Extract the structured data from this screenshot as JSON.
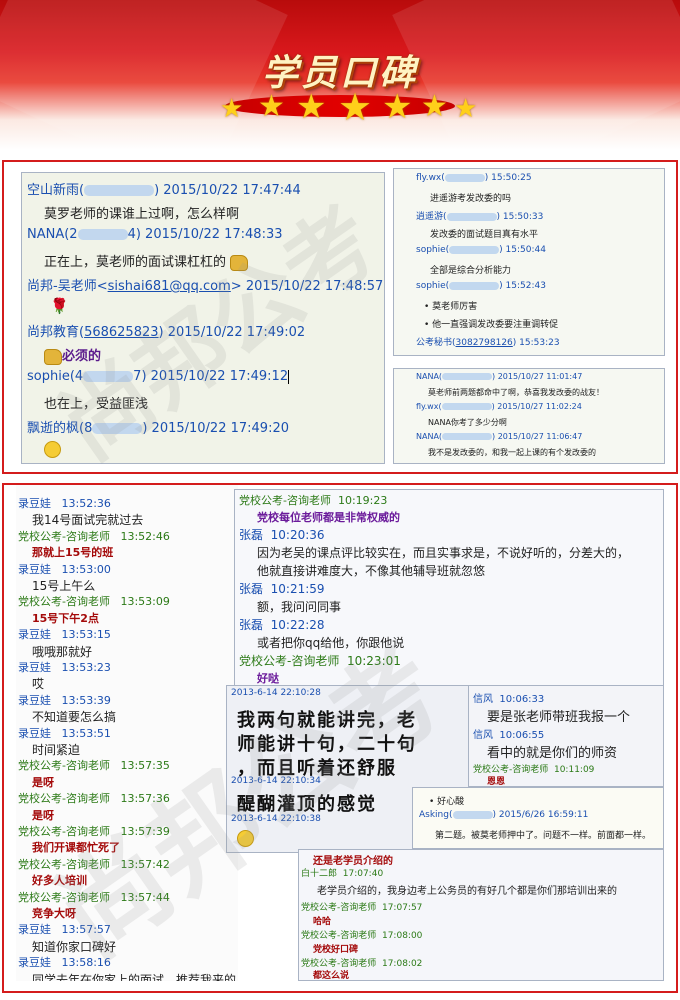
{
  "banner": {
    "title": "学员口碑"
  },
  "panel1": {
    "left_chat": [
      {
        "type": "name",
        "name": "空山新雨(",
        "tail": ") 2015/10/22 17:47:44"
      },
      {
        "type": "msg",
        "text": "莫罗老师的课谁上过啊，怎么样啊"
      },
      {
        "type": "name",
        "name": "NANA(2",
        "tail": "4) 2015/10/22 17:48:33"
      },
      {
        "type": "msg",
        "text": "正在上，莫老师的面试课杠杠的"
      },
      {
        "type": "name",
        "name": "尚邦-吴老师<",
        "email": "sishai681@qq.com",
        "tail": "> 2015/10/22 17:48:57"
      },
      {
        "type": "name",
        "name": "尚邦教育(",
        "qq": "568625823",
        "tail": ") 2015/10/22 17:49:02"
      },
      {
        "type": "msg",
        "text": "必须的"
      },
      {
        "type": "name",
        "name": "sophie(4",
        "tail": "7) 2015/10/22 17:49:12"
      },
      {
        "type": "msg",
        "text": "也在上，受益匪浅"
      },
      {
        "type": "name",
        "name": "飘逝的枫(8",
        "tail": ") 2015/10/22 17:49:20"
      }
    ],
    "right_top": [
      {
        "type": "name",
        "name": "fly.wx(",
        "tail": ") 15:50:25"
      },
      {
        "type": "msg",
        "text": "进遥游考发改委的吗"
      },
      {
        "type": "name",
        "name": "逍遥游(",
        "tail": ") 15:50:33"
      },
      {
        "type": "msg",
        "text": "发改委的面试题目真有水平"
      },
      {
        "type": "name",
        "name": "sophie(",
        "tail": ") 15:50:44"
      },
      {
        "type": "msg",
        "text": "全部是综合分析能力"
      },
      {
        "type": "name",
        "name": "sophie(",
        "tail": ") 15:52:43"
      },
      {
        "type": "msg",
        "text": "• 莫老师厉害"
      },
      {
        "type": "msg",
        "text": "• 他一直强调发改委要注重调转促"
      },
      {
        "type": "name",
        "name": "公考秘书(",
        "qq": "3082798126",
        "tail": ") 15:53:23"
      }
    ],
    "right_bottom": [
      {
        "type": "name",
        "name": "NANA(",
        "tail": ") 2015/10/27 11:01:47"
      },
      {
        "type": "msg",
        "text": "莫老师前两题都命中了啊，恭喜我发改委的战友！"
      },
      {
        "type": "name",
        "name": "fly.wx(",
        "tail": ") 2015/10/27 11:02:24"
      },
      {
        "type": "msg",
        "text": "NANA你考了多少分啊"
      },
      {
        "type": "name",
        "name": "NANA(",
        "tail": ") 2015/10/27 11:06:47"
      },
      {
        "type": "msg",
        "text": "我不是发改委的，和我一起上课的有个发改委的"
      }
    ]
  },
  "panel2": {
    "left_col": [
      {
        "type": "name",
        "name": "录豆娃",
        "tail": "13:52:36"
      },
      {
        "type": "msg",
        "text": "我14号面试完就过去"
      },
      {
        "type": "teacher",
        "name": "党校公考-咨询老师",
        "tail": "13:52:46"
      },
      {
        "type": "red",
        "text": "那就上15号的班"
      },
      {
        "type": "name",
        "name": "录豆娃",
        "tail": "13:53:00"
      },
      {
        "type": "msg",
        "text": "15号上午么"
      },
      {
        "type": "teacher",
        "name": "党校公考-咨询老师",
        "tail": "13:53:09"
      },
      {
        "type": "red",
        "text": "15号下午2点"
      },
      {
        "type": "name",
        "name": "录豆娃",
        "tail": "13:53:15"
      },
      {
        "type": "msg",
        "text": "哦哦那就好"
      },
      {
        "type": "name",
        "name": "录豆娃",
        "tail": "13:53:23"
      },
      {
        "type": "msg",
        "text": "哎"
      },
      {
        "type": "name",
        "name": "录豆娃",
        "tail": "13:53:39"
      },
      {
        "type": "msg",
        "text": "不知道要怎么搞"
      },
      {
        "type": "name",
        "name": "录豆娃",
        "tail": "13:53:51"
      },
      {
        "type": "msg",
        "text": "时间紧迫"
      },
      {
        "type": "teacher",
        "name": "党校公考-咨询老师",
        "tail": "13:57:35"
      },
      {
        "type": "red",
        "text": "是呀"
      },
      {
        "type": "teacher",
        "name": "党校公考-咨询老师",
        "tail": "13:57:36"
      },
      {
        "type": "red",
        "text": "是呀"
      },
      {
        "type": "teacher",
        "name": "党校公考-咨询老师",
        "tail": "13:57:39"
      },
      {
        "type": "red",
        "text": "我们开课都忙死了"
      },
      {
        "type": "teacher",
        "name": "党校公考-咨询老师",
        "tail": "13:57:42"
      },
      {
        "type": "red",
        "text": "好多人培训"
      },
      {
        "type": "teacher",
        "name": "党校公考-咨询老师",
        "tail": "13:57:44"
      },
      {
        "type": "red",
        "text": "竞争大呀"
      },
      {
        "type": "name",
        "name": "录豆娃",
        "tail": "13:57:57"
      },
      {
        "type": "msg",
        "text": "知道你家口碑好"
      },
      {
        "type": "name",
        "name": "录豆娃",
        "tail": "13:58:16"
      },
      {
        "type": "msg",
        "text": "同学去年在你家上的面试，推荐我来的"
      }
    ],
    "top_right": [
      {
        "type": "teacher",
        "name": "党校公考-咨询老师",
        "tail": "10:19:23"
      },
      {
        "type": "purple",
        "text": "党校每位老师都是非常权威的"
      },
      {
        "type": "name",
        "name": "张磊",
        "tail": "10:20:36"
      },
      {
        "type": "msg",
        "text": "因为老吴的课点评比较实在，而且实事求是，不说好听的，分差大的，"
      },
      {
        "type": "msg",
        "text": "他就直接讲难度大，不像其他辅导班就忽悠"
      },
      {
        "type": "name",
        "name": "张磊",
        "tail": "10:21:59"
      },
      {
        "type": "msg",
        "text": "额，我问问同事"
      },
      {
        "type": "name",
        "name": "张磊",
        "tail": "10:22:28"
      },
      {
        "type": "msg",
        "text": "或者把你qq给他，你跟他说"
      },
      {
        "type": "teacher",
        "name": "党校公考-咨询老师",
        "tail": "10:23:01"
      },
      {
        "type": "purple",
        "text": "好哒"
      }
    ],
    "mid_box": {
      "t1": "2013-6-14 22:10:28",
      "h1": "我两句就能讲完，老",
      "h2": "师能讲十句，二十句",
      "h3": "，而且听着还舒服",
      "t2": "2013-6-14 22:10:34",
      "h4": "醍醐灌顶的感觉",
      "t3": "2013-6-14 22:10:38"
    },
    "right_box": [
      {
        "type": "name",
        "name": "信风",
        "tail": "10:06:33"
      },
      {
        "type": "msg",
        "text": "要是张老师带班我报一个"
      },
      {
        "type": "name",
        "name": "信风",
        "tail": "10:06:55"
      },
      {
        "type": "msg",
        "text": "看中的就是你们的师资"
      },
      {
        "type": "teacher",
        "name": "党校公考-咨询老师",
        "tail": "10:11:09"
      },
      {
        "type": "red",
        "text": "恩恩"
      }
    ],
    "asking_box": {
      "l1": "• 好心酸",
      "name": "Asking(",
      "tail": ") 2015/6/26 16:59:11",
      "msg": "第二题。被莫老师押中了。问题不一样。前面都一样。"
    },
    "bottom_box": [
      {
        "type": "red",
        "text": "还是老学员介绍的"
      },
      {
        "type": "name",
        "name": "白十二郎",
        "tail": "17:07:40"
      },
      {
        "type": "msg",
        "text": "老学员介绍的，我身边考上公务员的有好几个都是你们那培训出来的"
      },
      {
        "type": "teacher",
        "name": "党校公考-咨询老师",
        "tail": "17:07:57"
      },
      {
        "type": "red",
        "text": "哈哈"
      },
      {
        "type": "teacher",
        "name": "党校公考-咨询老师",
        "tail": "17:08:00"
      },
      {
        "type": "red",
        "text": "党校好口碑"
      },
      {
        "type": "teacher",
        "name": "党校公考-咨询老师",
        "tail": "17:08:02"
      },
      {
        "type": "red",
        "text": "都这么说"
      }
    ]
  }
}
